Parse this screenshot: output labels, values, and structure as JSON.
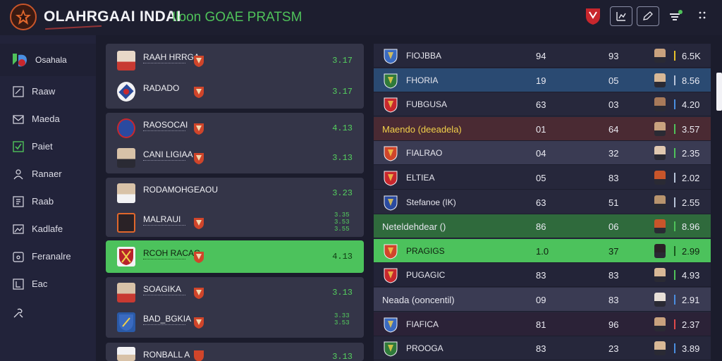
{
  "header": {
    "title": "OLAHRGAAI INDAI",
    "subtitle": "Iloon GOAE PRATSM"
  },
  "sidebar": {
    "home_label": "Osahala",
    "items": [
      {
        "label": "Raaw",
        "icon": "edit-icon"
      },
      {
        "label": "Maeda",
        "icon": "mail-icon"
      },
      {
        "label": "Paiet",
        "icon": "checkbox-icon"
      },
      {
        "label": "Ranaer",
        "icon": "user-icon"
      },
      {
        "label": "Raab",
        "icon": "list-icon"
      },
      {
        "label": "Kadlafe",
        "icon": "image-icon"
      },
      {
        "label": "Feranalre",
        "icon": "calendar-icon"
      },
      {
        "label": "Eac",
        "icon": "exit-icon"
      }
    ]
  },
  "matches": {
    "cards": [
      {
        "active": false,
        "rows": [
          {
            "name": "RAAH HRRGA",
            "odds": "3.17"
          },
          {
            "name": "RADADO",
            "odds": "3.17"
          }
        ]
      },
      {
        "active": false,
        "rows": [
          {
            "name": "RAOSOCAI",
            "odds": "4.13"
          },
          {
            "name": "CANI LIGIAA",
            "odds": "3.13"
          }
        ]
      },
      {
        "active": false,
        "rows": [
          {
            "name": "RODAMOHGEAOU",
            "odds": "3.23"
          },
          {
            "name": "MALRAUI",
            "odds": "3.35 3.53 3.55"
          }
        ]
      },
      {
        "active": true,
        "rows": [
          {
            "name": "RCOH RACAG",
            "odds": "4.13"
          }
        ]
      },
      {
        "active": false,
        "rows": [
          {
            "name": "SOAGIKA",
            "odds": "3.13"
          },
          {
            "name": "BAD_BGKIA",
            "odds": "3.33 3.53"
          }
        ]
      },
      {
        "active": false,
        "rows": [
          {
            "name": "RONBALL A",
            "odds": "3.13"
          }
        ]
      }
    ]
  },
  "standings": {
    "rows": [
      {
        "name": "FIOJBBA",
        "c1": "94",
        "c2": "93",
        "val": "6.5K",
        "bg": "#26273b",
        "bar": "#e8c22a",
        "wide": false
      },
      {
        "name": "FHORIA",
        "c1": "19",
        "c2": "05",
        "val": "8.56",
        "bg": "#2a4a72",
        "bar": "#b8c4d8",
        "wide": false
      },
      {
        "name": "FUBGUSA",
        "c1": "63",
        "c2": "03",
        "val": "4.20",
        "bg": "#27283c",
        "bar": "#4a8ee0",
        "wide": false
      },
      {
        "name": "Maendo (deeadela)",
        "c1": "01",
        "c2": "64",
        "val": "3.57",
        "bg": "#4a2a33",
        "bar": "#4fc25a",
        "wide": true
      },
      {
        "name": "FIALRAO",
        "c1": "04",
        "c2": "32",
        "val": "2.35",
        "bg": "#3a3b53",
        "bar": "#4fc25a",
        "wide": false
      },
      {
        "name": "ELTIEA",
        "c1": "05",
        "c2": "83",
        "val": "2.02",
        "bg": "#26273b",
        "bar": "#b8c4d8",
        "wide": false
      },
      {
        "name": "Stefanoe (IK)",
        "c1": "63",
        "c2": "51",
        "val": "2.55",
        "bg": "#27283c",
        "bar": "#b8c4d8",
        "wide": false
      },
      {
        "name": "Neteldehdear ()",
        "c1": "86",
        "c2": "06",
        "val": "8.96",
        "bg": "#2f6a3c",
        "bar": "#4fc25a",
        "wide": true
      },
      {
        "name": "PRAGIGS",
        "c1": "1.0",
        "c2": "37",
        "val": "2.99",
        "bg": "#4cc25c",
        "bar": "#1a5a1d",
        "wide": false
      },
      {
        "name": "PUGAGIC",
        "c1": "83",
        "c2": "83",
        "val": "4.93",
        "bg": "#232438",
        "bar": "#4fc25a",
        "wide": false
      },
      {
        "name": "Neada (ooncentil)",
        "c1": "09",
        "c2": "83",
        "val": "2.91",
        "bg": "#3a3b53",
        "bar": "#4a8ee0",
        "wide": true
      },
      {
        "name": "FIAFICA",
        "c1": "81",
        "c2": "96",
        "val": "2.37",
        "bg": "#2b2237",
        "bar": "#e04a4a",
        "wide": false
      },
      {
        "name": "PROOGA",
        "c1": "83",
        "c2": "23",
        "val": "3.89",
        "bg": "#26273b",
        "bar": "#4a8ee0",
        "wide": false
      }
    ]
  }
}
